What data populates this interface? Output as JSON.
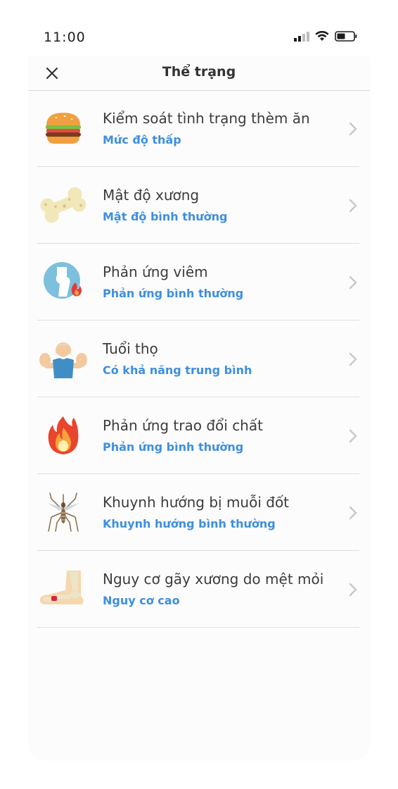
{
  "status_bar": {
    "time": "11:00"
  },
  "header": {
    "title": "Thể trạng",
    "close_icon": "close-icon"
  },
  "accent_color": "#3d8fe0",
  "items": [
    {
      "title": "Kiểm soát tình trạng thèm ăn",
      "subtitle": "Mức độ thấp",
      "icon": "burger-icon"
    },
    {
      "title": "Mật độ xương",
      "subtitle": "Mật độ bình thường",
      "icon": "bone-icon"
    },
    {
      "title": "Phản ứng viêm",
      "subtitle": "Phản ứng bình thường",
      "icon": "inflamed-joint-icon"
    },
    {
      "title": "Tuổi thọ",
      "subtitle": "Có khả năng trung bình",
      "icon": "elderly-man-icon"
    },
    {
      "title": "Phản ứng trao đổi chất",
      "subtitle": "Phản ứng bình thường",
      "icon": "fire-icon"
    },
    {
      "title": "Khuynh hướng bị muỗi đốt",
      "subtitle": "Khuynh hướng bình thường",
      "icon": "mosquito-icon"
    },
    {
      "title": "Nguy cơ gãy xương do mệt mỏi",
      "subtitle": "Nguy cơ cao",
      "icon": "foot-bone-icon"
    }
  ]
}
